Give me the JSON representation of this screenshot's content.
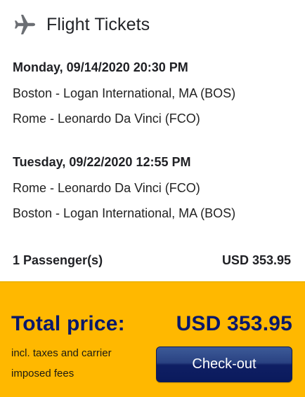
{
  "header": {
    "icon": "airplane-icon",
    "title": "Flight Tickets"
  },
  "flights": [
    {
      "date": "Monday, 09/14/2020 20:30 PM",
      "from": "Boston - Logan International, MA (BOS)",
      "to": "Rome - Leonardo Da Vinci (FCO)"
    },
    {
      "date": "Tuesday, 09/22/2020 12:55 PM",
      "from": "Rome - Leonardo Da Vinci (FCO)",
      "to": "Boston - Logan International, MA (BOS)"
    }
  ],
  "summary": {
    "passengers_label": "1 Passenger(s)",
    "passengers_price": "USD 353.95"
  },
  "total": {
    "label": "Total price:",
    "value": "USD 353.95",
    "fees_note": "incl. taxes and carrier imposed fees",
    "checkout_label": "Check-out"
  },
  "colors": {
    "accent_panel": "#ffb800",
    "total_text": "#09186a",
    "button": "#1d3278"
  }
}
